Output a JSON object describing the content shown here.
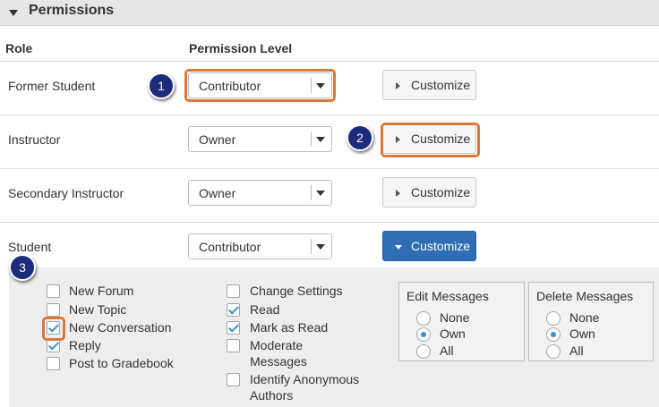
{
  "section": {
    "title": "Permissions"
  },
  "columns": {
    "role": "Role",
    "permission_level": "Permission Level"
  },
  "rows": [
    {
      "role": "Former Student",
      "level": "Contributor",
      "customize": "Customize"
    },
    {
      "role": "Instructor",
      "level": "Owner",
      "customize": "Customize"
    },
    {
      "role": "Secondary Instructor",
      "level": "Owner",
      "customize": "Customize"
    },
    {
      "role": "Student",
      "level": "Contributor",
      "customize": "Customize"
    }
  ],
  "markers": [
    "1",
    "2",
    "3"
  ],
  "customize_panel": {
    "col1": [
      {
        "label": "New Forum",
        "checked": false
      },
      {
        "label": "New Topic",
        "checked": false
      },
      {
        "label": "New Conversation",
        "checked": true
      },
      {
        "label": "Reply",
        "checked": true
      },
      {
        "label": "Post to Gradebook",
        "checked": false
      }
    ],
    "col2": [
      {
        "label": "Change Settings",
        "checked": false
      },
      {
        "label": "Read",
        "checked": true
      },
      {
        "label": "Mark as Read",
        "checked": true
      },
      {
        "label": "Moderate Messages",
        "checked": false
      },
      {
        "label": "Identify Anonymous Authors",
        "checked": false
      }
    ],
    "edit_messages": {
      "legend": "Edit Messages",
      "options": [
        "None",
        "Own",
        "All"
      ],
      "selected": "Own"
    },
    "delete_messages": {
      "legend": "Delete Messages",
      "options": [
        "None",
        "Own",
        "All"
      ],
      "selected": "Own"
    }
  },
  "colors": {
    "accent": "#2f6db5",
    "highlight": "#d97a3a",
    "marker": "#1c2b7c",
    "check": "#3a8fd6"
  }
}
